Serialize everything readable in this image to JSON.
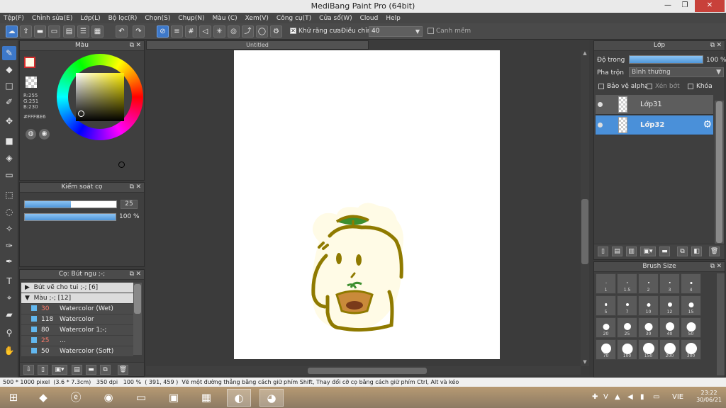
{
  "window": {
    "title": "MediBang Paint Pro (64bit)",
    "min": "—",
    "max": "❐",
    "close": "✕"
  },
  "menu": [
    "Tệp(F)",
    "Chỉnh sửa(E)",
    "Lớp(L)",
    "Bộ lọc(R)",
    "Chọn(S)",
    "Chụp(N)",
    "Màu (C)",
    "Xem(V)",
    "Công cụ(T)",
    "Cửa sổ(W)",
    "Cloud",
    "Help"
  ],
  "toolbar": {
    "antialias_label": "Khử răng cưa",
    "antialias_checked": "✕",
    "adjust_label": "Điều chỉnh",
    "adjust_value": "40",
    "edge_label": "Canh mềm"
  },
  "color_panel": {
    "title": "Màu",
    "r": "R:255",
    "g": "G:251",
    "b": "B:230",
    "hex": "#FFFBE6",
    "fg_color": "#fffbe6"
  },
  "brush_control": {
    "title": "Kiểm soát cọ",
    "size_value": "25",
    "size_fraction": 0.5,
    "opacity_value": "100 %",
    "opacity_fraction": 1.0
  },
  "brush_list": {
    "title": "Cọ: Bút ngu ;-;",
    "groups": [
      {
        "arrow": "▶",
        "label": "Bút vẽ cho tui ;-; [6]"
      },
      {
        "arrow": "▼",
        "label": "Màu ;-; [12]"
      }
    ],
    "items": [
      {
        "num": "30",
        "name": "Watercolor (Wet)",
        "red": true
      },
      {
        "num": "118",
        "name": "Watercolor",
        "red": false
      },
      {
        "num": "80",
        "name": "Watercolor 1;-;",
        "red": false
      },
      {
        "num": "25",
        "name": "...",
        "red": true
      },
      {
        "num": "50",
        "name": "Watercolor (Soft)",
        "red": false
      }
    ]
  },
  "canvas": {
    "tab": "Untitled"
  },
  "layer_panel": {
    "title": "Lớp",
    "opacity_label": "Độ trong",
    "opacity_value": "100 %",
    "blend_label": "Pha trộn",
    "blend_value": "Bình thường",
    "protect_alpha": "Bảo vệ alpha",
    "clipping": "Xén bớt",
    "lock": "Khóa",
    "layers": [
      {
        "name": "Lớp31",
        "selected": false
      },
      {
        "name": "Lớp32",
        "selected": true
      }
    ]
  },
  "brush_size": {
    "title": "Brush Size",
    "sizes": [
      "1",
      "1.5",
      "2",
      "3",
      "4",
      "5",
      "7",
      "10",
      "12",
      "15",
      "20",
      "25",
      "30",
      "40",
      "50",
      "70",
      "100",
      "150",
      "200",
      "300"
    ]
  },
  "status": {
    "size": "500 * 1000 pixel",
    "cm": "(3.6 * 7.3cm)",
    "dpi": "350 dpi",
    "zoom": "100 %",
    "coords": "( 391, 459 )",
    "hint": "Vẽ một đường thẳng bằng cách giữ phím Shift, Thay đổi cỡ cọ bằng cách giữ phím Ctrl, Alt và kéo"
  },
  "taskbar": {
    "lang": "VIE",
    "time": "23:22",
    "date": "30/06/21"
  }
}
